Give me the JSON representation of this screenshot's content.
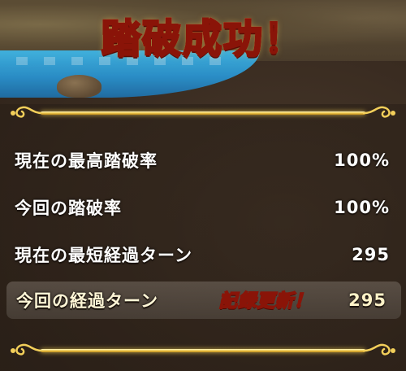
{
  "title": "踏破成功！",
  "rows": [
    {
      "label": "現在の最高踏破率",
      "value": "100%"
    },
    {
      "label": "今回の踏破率",
      "value": "100%"
    },
    {
      "label": "現在の最短経過ターン",
      "value": "295"
    },
    {
      "label": "今回の経過ターン",
      "value": "295",
      "badge": "記録更新！"
    }
  ],
  "colors": {
    "accent_gold": "#f0c84a",
    "title_fill": "#ffd860",
    "title_outline": "#8a1408",
    "text": "#ffffff"
  },
  "icons": [
    "ornament-flourish-icon"
  ]
}
